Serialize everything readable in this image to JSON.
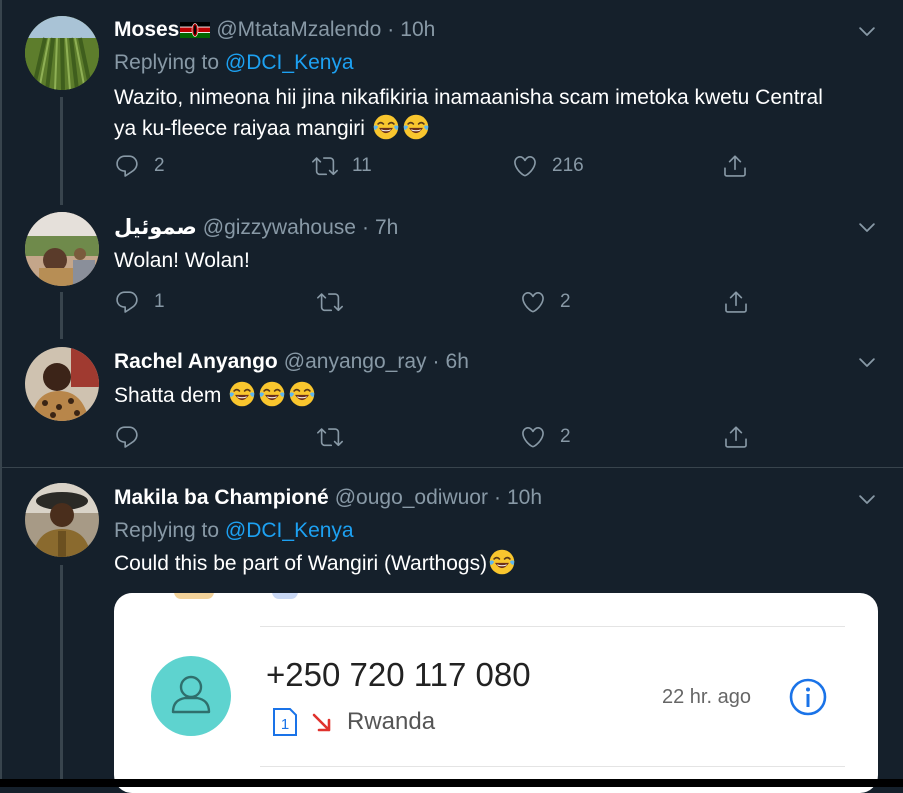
{
  "colors": {
    "background": "#15202b",
    "border": "#38444d",
    "text_primary": "#ffffff",
    "text_secondary": "#8899a6",
    "link": "#1da1f2",
    "call_accent": "#5ed3cf",
    "missed_call_red": "#e0322d",
    "info_blue": "#1a73e8"
  },
  "tweets": [
    {
      "name": "Moses",
      "name_flag": "kenya-flag-icon",
      "handle": "@MtataMzalendo",
      "separator": "·",
      "time": "10h",
      "replying_label": "Replying to",
      "replying_to": "@DCI_Kenya",
      "text_line1": "Wazito, nimeona hii jina nikafikiria inamaanisha scam imetoka kwetu Central",
      "text_line2": "ya ku-fleece raiyaa mangiri",
      "emojis": [
        "face-with-tears-of-joy-icon",
        "face-with-tears-of-joy-icon"
      ],
      "replies": "2",
      "retweets": "11",
      "likes": "216"
    },
    {
      "name": "صموئيل",
      "handle": "@gizzywahouse",
      "separator": "·",
      "time": "7h",
      "text": "Wolan! Wolan!",
      "replies": "1",
      "retweets": "",
      "likes": "2"
    },
    {
      "name": "Rachel Anyango",
      "handle": "@anyango_ray",
      "separator": "·",
      "time": "6h",
      "text": "Shatta dem",
      "emojis": [
        "face-with-tears-of-joy-icon",
        "face-with-tears-of-joy-icon",
        "face-with-tears-of-joy-icon"
      ],
      "replies": "",
      "retweets": "",
      "likes": "2"
    },
    {
      "name": "Makila ba Championé",
      "handle": "@ougo_odiwuor",
      "separator": "·",
      "time": "10h",
      "replying_label": "Replying to",
      "replying_to": "@DCI_Kenya",
      "text": "Could this be part of Wangiri (Warthogs)",
      "emojis": [
        "face-with-tears-of-joy-icon"
      ]
    }
  ],
  "media_card": {
    "phone_number": "+250 720 117 080",
    "sim_label": "1",
    "country": "Rwanda",
    "time_ago": "22 hr. ago"
  }
}
